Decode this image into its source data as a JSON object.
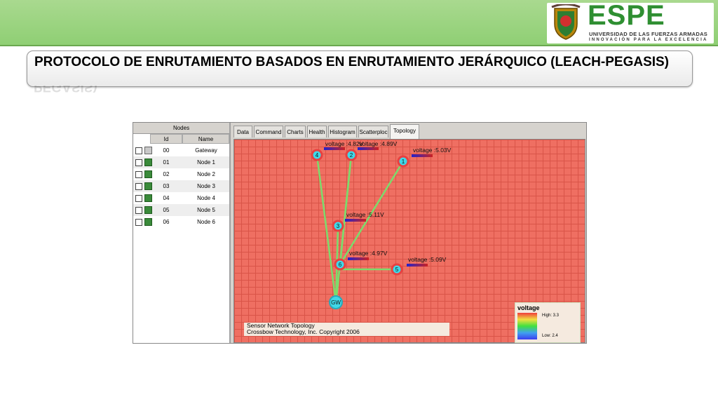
{
  "header": {
    "brand": "ESPE",
    "university": "UNIVERSIDAD DE LAS FUERZAS ARMADAS",
    "motto": "INNOVACIÓN PARA LA EXCELENCIA",
    "title": "PROTOCOLO DE ENRUTAMIENTO BASADOS EN ENRUTAMIENTO JERÁRQUICO (LEACH-PEGASIS)",
    "title_reflection": "PEGASIS)",
    "colors": {
      "band": "#8fcf74",
      "brand": "#2f8f32"
    }
  },
  "nodes_panel": {
    "title": "Nodes",
    "columns": [
      "Id",
      "Name"
    ],
    "rows": [
      {
        "id": "00",
        "name": "Gateway"
      },
      {
        "id": "01",
        "name": "Node 1"
      },
      {
        "id": "02",
        "name": "Node 2"
      },
      {
        "id": "03",
        "name": "Node 3"
      },
      {
        "id": "04",
        "name": "Node 4"
      },
      {
        "id": "05",
        "name": "Node 5"
      },
      {
        "id": "06",
        "name": "Node 6"
      }
    ]
  },
  "tabs": [
    "Data",
    "Command",
    "Charts",
    "Health",
    "Histogram",
    "Scatterploc",
    "Topology"
  ],
  "active_tab": "Topology",
  "topology": {
    "nodes": [
      {
        "label": "4",
        "voltage": "voltage :4.82V"
      },
      {
        "label": "2",
        "voltage": "voltage :4.89V"
      },
      {
        "label": "1",
        "voltage": "voltage :5.03V"
      },
      {
        "label": "3",
        "voltage": "voltage :5.11V"
      },
      {
        "label": "6",
        "voltage": "voltage :4.97V"
      },
      {
        "label": "5",
        "voltage": "voltage :5.09V"
      },
      {
        "label": "GW",
        "voltage": ""
      }
    ],
    "legend": {
      "title": "voltage",
      "high": "High: 3.3",
      "low": "Low:  2.4"
    },
    "caption_line1": "Sensor Network Topology",
    "caption_line2": "Crossbow Technology, Inc. Copyright 2006",
    "colors": {
      "background": "#ef6f62",
      "grid": "#d95448",
      "link": "#7cdc6c",
      "node": "#40d8e8"
    }
  }
}
